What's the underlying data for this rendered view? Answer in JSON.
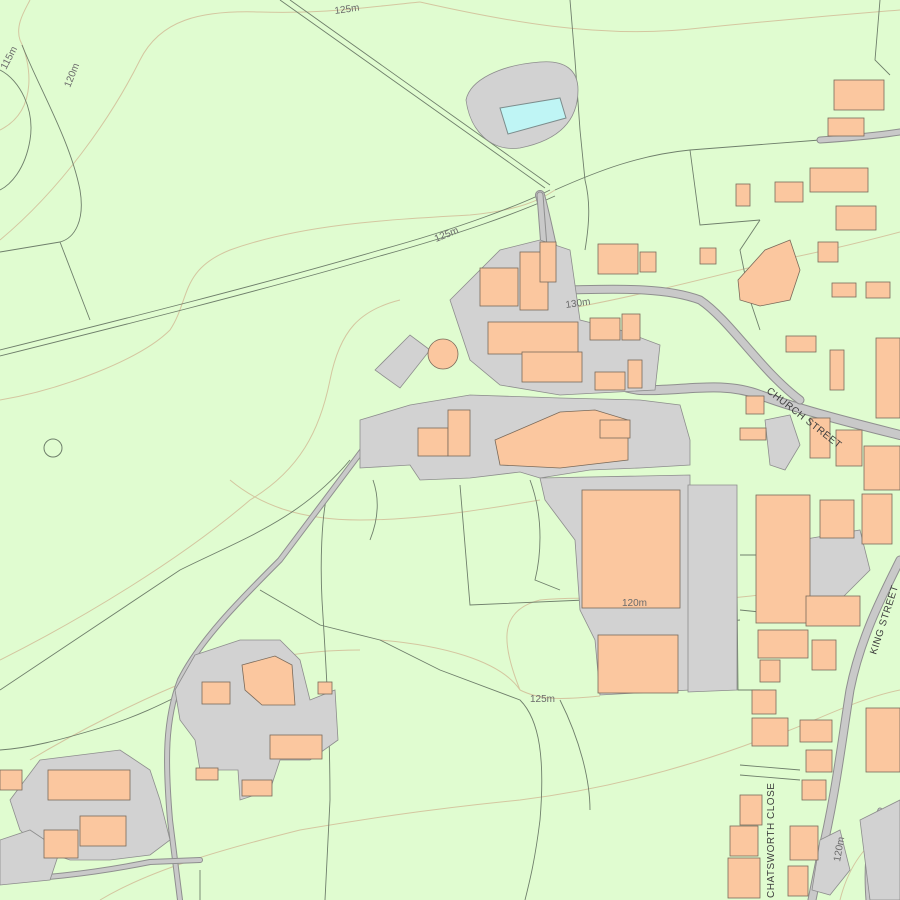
{
  "map": {
    "colors": {
      "land": "#e0fcd0",
      "building": "#fbc79f",
      "paved": "#d2d2d2",
      "water": "#bff5f5",
      "contour": "#d4c6a0",
      "boundary": "#6f7f6b"
    },
    "contour_labels": [
      "125m",
      "115m",
      "120m",
      "125m",
      "130m",
      "120m",
      "125m",
      "120m"
    ],
    "street_labels": {
      "church_street": "CHURCH STREET",
      "king_street": "KING STREET",
      "chatsworth_close": "CHATSWORTH CLOSE"
    }
  }
}
